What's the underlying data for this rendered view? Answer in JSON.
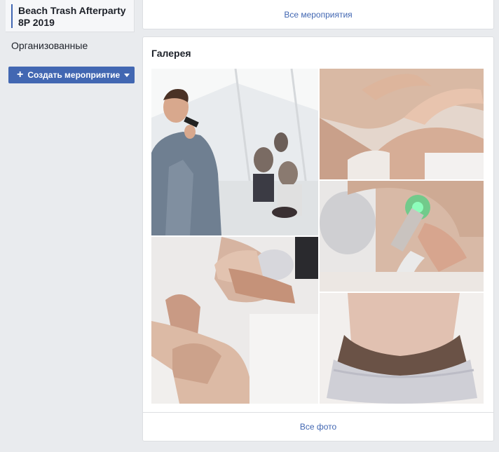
{
  "sidebar": {
    "event_title": "Beach Trash Afterparty 8P 2019",
    "organized_label": "Организованные",
    "create_button_label": "Создать мероприятие"
  },
  "top_card": {
    "all_events_link": "Все мероприятия"
  },
  "gallery": {
    "title": "Галерея",
    "all_photos_link": "Все фото",
    "photos": [
      {
        "name": "photo-speaker-with-microphone"
      },
      {
        "name": "photo-neck-treatment"
      },
      {
        "name": "photo-green-light-device"
      },
      {
        "name": "photo-face-massage"
      },
      {
        "name": "photo-forehead-with-cap"
      }
    ]
  },
  "colors": {
    "page_bg": "#e9ebee",
    "accent": "#4267b2",
    "text": "#1d2129",
    "card_border": "#dddfe2"
  }
}
